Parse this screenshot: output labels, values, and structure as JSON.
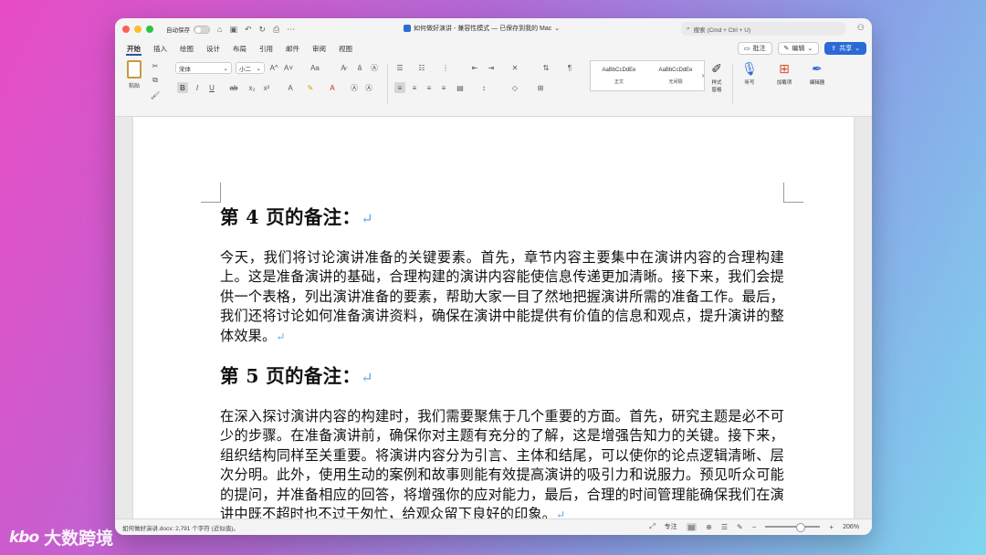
{
  "titlebar": {
    "autosave_label": "自动保存",
    "document_title": "如何做好演讲 - 兼容性模式 — 已保存到我的 Mac",
    "search_placeholder": "搜索 (Cmd + Ctrl + U)"
  },
  "tabs": [
    "开始",
    "插入",
    "绘图",
    "设计",
    "布局",
    "引用",
    "邮件",
    "审阅",
    "视图"
  ],
  "tab_actions": {
    "comments": "批注",
    "editing": "编辑",
    "share": "共享"
  },
  "ribbon": {
    "paste_label": "粘贴",
    "font_name": "宋体",
    "font_size": "小二",
    "font_grow": "A^",
    "font_shrink": "A˅",
    "change_case": "Aa",
    "styles": [
      {
        "preview": "AaBbCcDdEe",
        "caption": "正文"
      },
      {
        "preview": "AaBbCcDdEe",
        "caption": "无间隔"
      }
    ],
    "styles_pane_label": "样式\n窗格",
    "dictate_label": "听写",
    "addins_label": "加载项",
    "editor_label": "编辑器"
  },
  "document": {
    "section1_heading": "第 4 页的备注：",
    "section1_body": "今天，我们将讨论演讲准备的关键要素。首先，章节内容主要集中在演讲内容的合理构建上。这是准备演讲的基础，合理构建的演讲内容能使信息传递更加清晰。接下来，我们会提供一个表格，列出演讲准备的要素，帮助大家一目了然地把握演讲所需的准备工作。最后，我们还将讨论如何准备演讲资料，确保在演讲中能提供有价值的信息和观点，提升演讲的整体效果。",
    "section2_heading": "第 5 页的备注：",
    "section2_body": "在深入探讨演讲内容的构建时，我们需要聚焦于几个重要的方面。首先，研究主题是必不可少的步骤。在准备演讲前，确保你对主题有充分的了解，这是增强告知力的关键。接下来，组织结构同样至关重要。将演讲内容分为引言、主体和结尾，可以使你的论点逻辑清晰、层次分明。此外，使用生动的案例和故事则能有效提高演讲的吸引力和说服力。预见听众可能的提问，并准备相应的回答，将增强你的应对能力，最后，合理的时间管理能确保我们在演讲中既不超时也不过于匆忙，给观众留下良好的印象。",
    "paragraph_mark": "↵"
  },
  "statusbar": {
    "word_count": "如何做好演讲.docx: 2,791 个字符 (近似值)。",
    "focus_label": "专注",
    "zoom": "206%"
  },
  "watermark": {
    "mark": "kbo",
    "text": "大数跨境"
  },
  "colors": {
    "accent": "#2b6ad6",
    "paragraph_mark": "#6aa6e8"
  }
}
